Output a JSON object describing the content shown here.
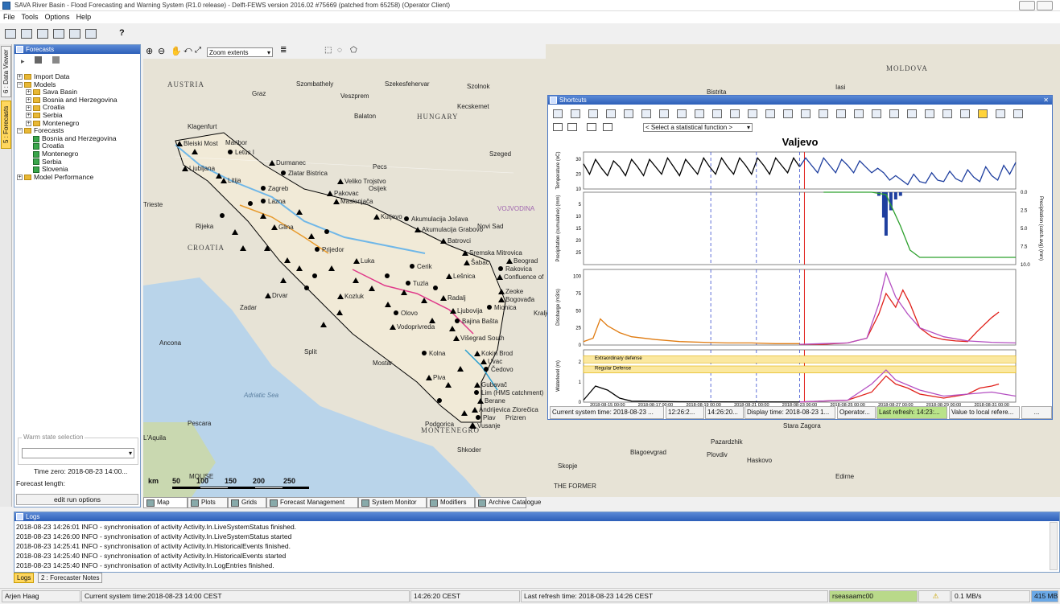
{
  "window": {
    "title": "SAVA River Basin - Flood Forecasting and Warning System (R1.0 release) - Delft-FEWS version 2016.02 #75669 (patched from 65258) (Operator Client)"
  },
  "menu": [
    "File",
    "Tools",
    "Options",
    "Help"
  ],
  "vertical_tabs": [
    "6 : Data Viewer",
    "5 : Forecasts"
  ],
  "forecasts_panel": {
    "title": "Forecasts",
    "tree": [
      "Import Data",
      "Models",
      "Sava Basin",
      "Bosnia and Herzegovina",
      "Croatia",
      "Serbia",
      "Montenegro",
      "Forecasts",
      "Bosnia and Herzegovina",
      "Croatia",
      "Montenegro",
      "Serbia",
      "Slovenia",
      "Model Performance"
    ],
    "warm_state_label": "Warm state selection",
    "time_zero": "Time zero:  2018-08-23 14:00...",
    "forecast_length": "Forecast length:",
    "edit_button": "edit run options"
  },
  "map_toolbar": {
    "zoom_value": "Zoom extents"
  },
  "map": {
    "countries": [
      "AUSTRIA",
      "HUNGARY",
      "CROATIA",
      "MOLDOVA",
      "MONTENEGRO"
    ],
    "labels": [
      "Graz",
      "Szombathely",
      "Szekesfehervar",
      "Szolnok",
      "Veszprem",
      "Kecskemet",
      "Balaton",
      "Klagenfurt",
      "Maribor",
      "Bistrita",
      "Iasi",
      "Szeged",
      "Pecs",
      "Trieste",
      "Rijeka",
      "Osijek",
      "Novi Sad",
      "Zadar",
      "Split",
      "Mostar",
      "Ancona",
      "Pescara",
      "Adriatic Sea",
      "Podgorica",
      "Prizren",
      "Shkoder",
      "Skopje",
      "Blagoevgrad",
      "Plovdiv",
      "Haskovo",
      "Edirne",
      "Stara Zagora",
      "Pazardzhik",
      "VOJVODINA",
      "Kraljevo",
      "L'Aquila",
      "MOLISE",
      "THE FORMER"
    ],
    "stations": [
      "Bleiski Most",
      "Letus I",
      "Durmanec",
      "Ljubljana",
      "Zlatar Bistrica",
      "Litija",
      "Veliko Trojstvo",
      "Zagreb",
      "Pakovac",
      "Maslenjača",
      "Lazna",
      "Kutjevo",
      "Glina",
      "Akumulacija Jošava",
      "Akumulacija Grabovo",
      "Batrovci",
      "Prijedor",
      "Sremska Mitrovica",
      "Beograd",
      "Rakovica",
      "Confluence of",
      "Šabac",
      "Cerik",
      "Luka",
      "Lešnica",
      "Tuzla",
      "Zeoke",
      "Bogovađa",
      "Mionica",
      "Drvar",
      "Kozluk",
      "Olovo",
      "Radalj",
      "Ljubovija",
      "Bajina Bašta",
      "Vodoprivreda",
      "Višegrad South",
      "Kolna",
      "Kokin Brod",
      "Uvac",
      "Čedovo",
      "Piva",
      "Gubavač",
      "Lim (HMS catchment)",
      "Berane",
      "Andrijevica Zlorečica",
      "Plav",
      "Vusanje"
    ],
    "scale": [
      "km",
      "50",
      "100",
      "150",
      "200",
      "250"
    ]
  },
  "bottom_tabs": [
    "Map",
    "Plots",
    "Grids",
    "Forecast Management",
    "System Monitor",
    "Modifiers",
    "Archive Catalogue"
  ],
  "shortcuts": {
    "title": "Shortcuts",
    "stat_select": "< Select a statistical function >",
    "status": [
      "Current system time: 2018-08-23 ...",
      "12:26:2...",
      "14:26:20...",
      "Display time: 2018-08-23 1...",
      "Operator...",
      "Last refresh: 14:23:...",
      "Value to local refere...",
      "..."
    ]
  },
  "chart_data": {
    "type": "line",
    "title": "Valjevo",
    "x_ticks": [
      "2018-08-15 00:00",
      "2018-08-17 00:00",
      "2018-08-19 00:00",
      "2018-08-21 00:00",
      "2018-08-23 00:00",
      "2018-08-25 00:00",
      "2018-08-27 00:00",
      "2018-08-29 00:00",
      "2018-08-31 00:00"
    ],
    "panels": [
      {
        "ylabel": "Temperature (oC)",
        "yticks": [
          "30",
          "20",
          "10"
        ],
        "ylim": [
          10,
          35
        ],
        "series": [
          {
            "color": "#000000",
            "x": [
              14.0,
              14.25,
              14.5,
              14.75,
              15.0,
              15.25,
              15.5,
              15.75,
              16.0,
              16.25,
              16.5,
              16.75,
              17.0,
              17.25,
              17.5,
              17.75,
              18.0,
              18.25,
              18.5,
              18.75,
              19.0,
              19.25,
              19.5,
              19.75,
              20.0,
              20.25,
              20.5,
              20.75,
              21.0,
              21.25,
              21.5,
              21.75,
              22.0,
              22.25,
              22.5,
              22.75,
              23.0
            ],
            "y": [
              27,
              20,
              30,
              24,
              19,
              29,
              25,
              19,
              30,
              25,
              19,
              30,
              25,
              20,
              31,
              25,
              19,
              30,
              25,
              20,
              31,
              25,
              20,
              31,
              25,
              20,
              31,
              26,
              20,
              31,
              26,
              20,
              31,
              26,
              21,
              31,
              25
            ]
          },
          {
            "color": "#1f3f9f",
            "x": [
              23.0,
              23.25,
              23.5,
              23.75,
              24.0,
              24.25,
              24.5,
              24.75,
              25.0,
              25.25,
              25.5,
              25.75,
              26.0,
              26.25,
              26.5,
              26.75,
              27.0,
              27.25,
              27.5,
              27.75,
              28.0,
              28.25,
              28.5,
              28.75,
              29.0,
              29.25,
              29.5,
              29.75,
              30.0,
              30.25,
              30.5,
              30.75,
              31.0,
              31.25,
              31.5,
              31.75,
              32.0
            ],
            "y": [
              25,
              31,
              26,
              21,
              31,
              26,
              21,
              30,
              26,
              21,
              29,
              25,
              21,
              24,
              21,
              16,
              19,
              16,
              13,
              20,
              15,
              14,
              21,
              16,
              15,
              22,
              17,
              15,
              23,
              18,
              15,
              25,
              19,
              16,
              26,
              20,
              28
            ]
          }
        ]
      },
      {
        "ylabel": "Precipitation (cumulative) (mm)",
        "ylabel_right": "Precipitation (catch.avg) (mm)",
        "yticks": [
          "5",
          "10",
          "15",
          "20",
          "25"
        ],
        "yticks_right": [
          "0.0",
          "2.5",
          "5.0",
          "7.5",
          "10.0"
        ],
        "ylim": [
          0,
          30
        ],
        "series": [
          {
            "color": "#2ca02c",
            "x": [
              24.0,
              26.0,
              26.6,
              27.2,
              27.6,
              28.0,
              32.0
            ],
            "y": [
              0,
              0,
              1,
              14,
              24,
              27,
              27
            ]
          }
        ],
        "bars": {
          "color": "#1f3f9f",
          "x": [
            26.3,
            26.5,
            26.6,
            26.8,
            27.0,
            27.2
          ],
          "y": [
            0.5,
            3.5,
            6.0,
            2.5,
            1.0,
            0.5
          ]
        }
      },
      {
        "ylabel": "Discharge (m3/s)",
        "yticks": [
          "100",
          "75",
          "50",
          "25",
          "0"
        ],
        "ylim": [
          0,
          110
        ],
        "series": [
          {
            "color": "#e07b10",
            "x": [
              14.0,
              14.4,
              14.7,
              15.0,
              15.5,
              16.0,
              17.0,
              18.0,
              19.0,
              20.0,
              21.0,
              22.0,
              23.0
            ],
            "y": [
              5,
              10,
              38,
              28,
              18,
              12,
              8,
              5,
              4,
              3,
              3,
              2,
              2
            ]
          },
          {
            "color": "#e0201a",
            "x": [
              23.0,
              24.0,
              25.0,
              25.8,
              26.3,
              26.6,
              27.0,
              27.3,
              27.6,
              28.0,
              28.5,
              29.0,
              29.5,
              30.0,
              30.4,
              31.0,
              31.3
            ],
            "y": [
              1,
              1,
              3,
              10,
              45,
              75,
              55,
              80,
              60,
              25,
              12,
              8,
              6,
              5,
              20,
              40,
              48
            ]
          },
          {
            "color": "#b44fc2",
            "x": [
              23.0,
              25.0,
              25.8,
              26.3,
              26.6,
              27.0,
              27.5,
              28.0,
              29.0,
              30.0,
              31.0,
              32.0
            ],
            "y": [
              1,
              3,
              10,
              60,
              105,
              70,
              45,
              25,
              12,
              6,
              4,
              3
            ]
          }
        ]
      },
      {
        "ylabel": "Waterlevel (m)",
        "yticks": [
          "2",
          "1",
          "0"
        ],
        "ylim": [
          0,
          2.6
        ],
        "bands": [
          "Extraordinary defense",
          "Regular Defense"
        ],
        "series": [
          {
            "color": "#000000",
            "x": [
              14.0,
              14.5,
              15.0,
              15.5,
              16.0,
              18.0,
              23.0
            ],
            "y": [
              0.1,
              0.8,
              0.6,
              0.2,
              0.05,
              0.02,
              0.01
            ]
          },
          {
            "color": "#e0201a",
            "x": [
              23.0,
              25.0,
              26.0,
              26.6,
              27.0,
              27.5,
              28.0,
              29.0,
              30.0,
              30.5,
              31.0,
              31.3
            ],
            "y": [
              0.01,
              0.1,
              0.5,
              1.3,
              0.9,
              0.7,
              0.4,
              0.2,
              0.4,
              0.7,
              0.8,
              0.9
            ]
          },
          {
            "color": "#b44fc2",
            "x": [
              23.0,
              25.0,
              26.0,
              26.6,
              27.0,
              28.0,
              29.0,
              30.0,
              31.0,
              32.0
            ],
            "y": [
              0.01,
              0.1,
              0.9,
              1.6,
              1.1,
              0.6,
              0.3,
              0.4,
              0.5,
              0.3
            ]
          }
        ]
      }
    ]
  },
  "logs": {
    "title": "Logs",
    "lines": [
      "2018-08-23 14:26:01 INFO - synchronisation of activity Activity.In.LiveSystemStatus finished.",
      "2018-08-23 14:26:00 INFO - synchronisation of activity Activity.In.LiveSystemStatus started",
      "2018-08-23 14:25:41 INFO - synchronisation of activity Activity.In.HistoricalEvents finished.",
      "2018-08-23 14:25:40 INFO - synchronisation of activity Activity.In.HistoricalEvents started",
      "2018-08-23 14:25:40 INFO - synchronisation of activity Activity.In.LogEntries finished."
    ],
    "tabs": [
      "Logs",
      "2 : Forecaster Notes"
    ]
  },
  "status_bar": {
    "user": "Arjen Haag",
    "system_time": "Current system time:2018-08-23 14:00 CEST",
    "clock": "14:26:20 CEST",
    "last_refresh": "Last refresh time: 2018-08-23 14:26 CEST",
    "server": "rseasaamc00",
    "rate": "0.1 MB/s",
    "memory": "415 MB"
  },
  "colors": {
    "accent": "#2d5fb8",
    "warning_band": "#fbe8a0",
    "server_ok": "#b9d98a"
  }
}
